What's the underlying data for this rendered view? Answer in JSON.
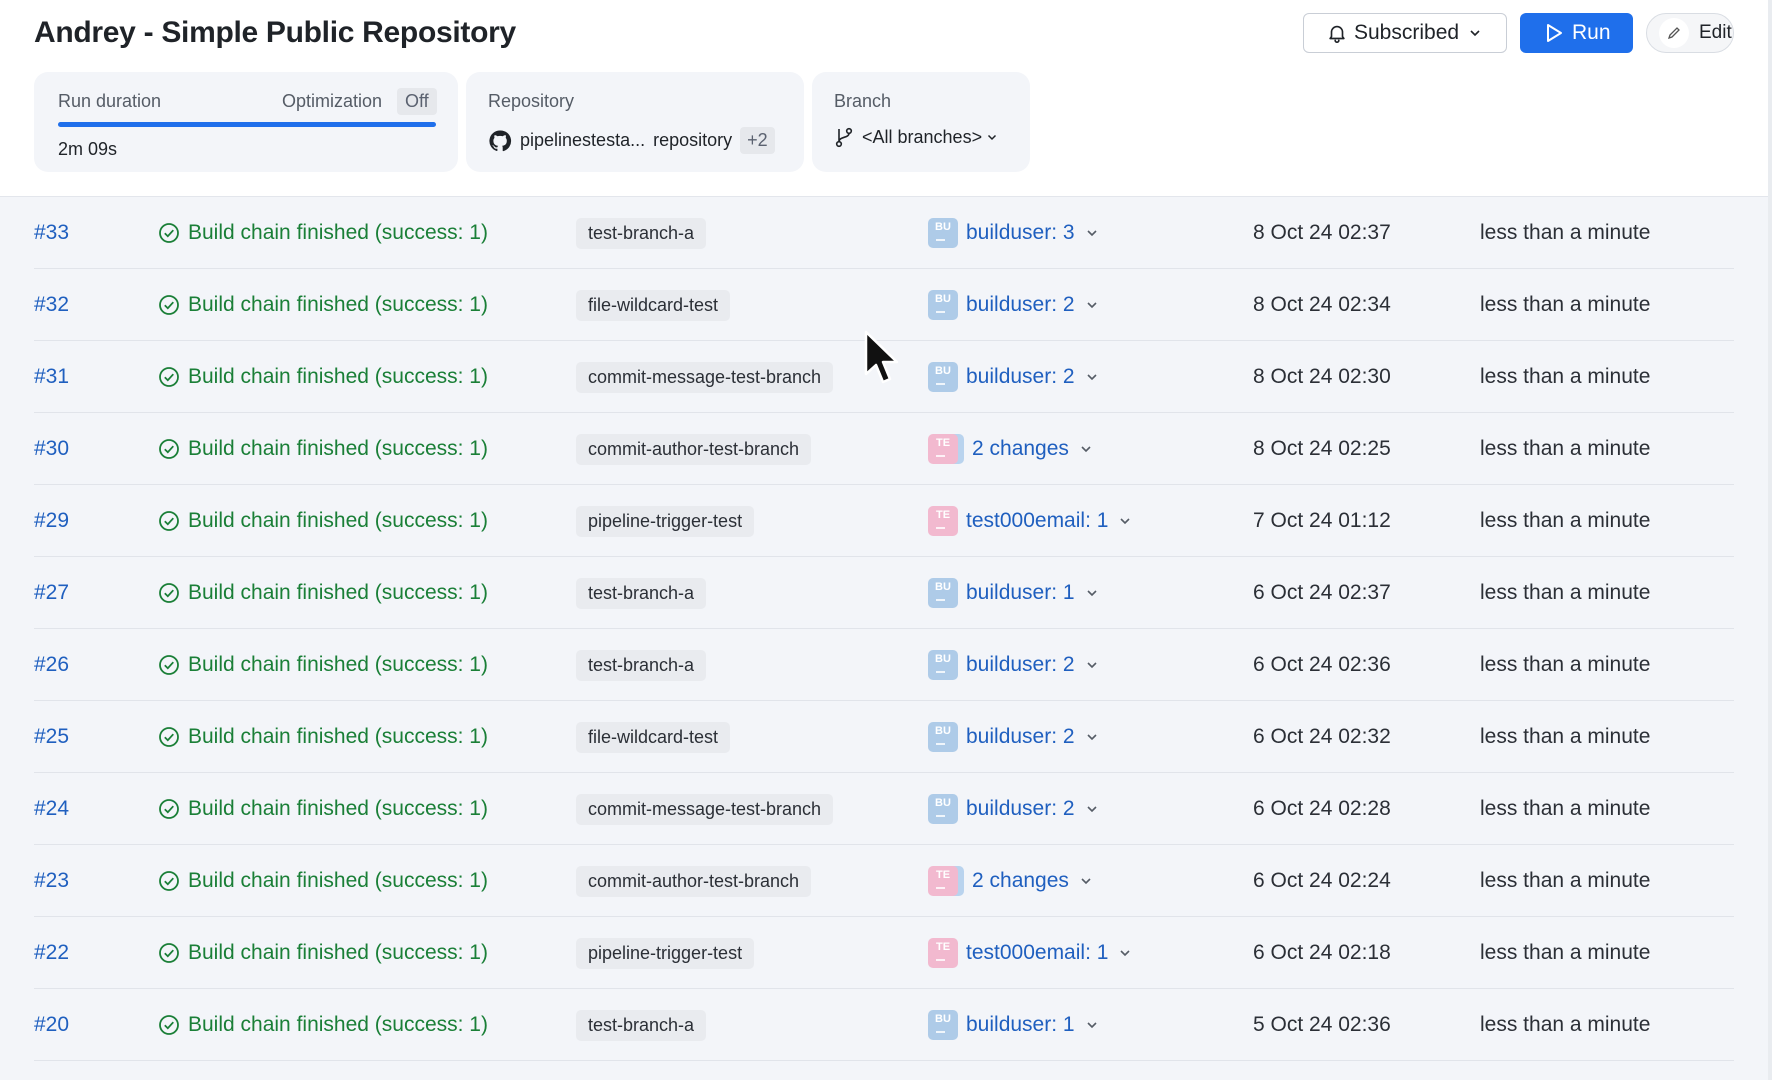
{
  "title": "Andrey - Simple Public Repository",
  "actions": {
    "subscribed_label": "Subscribed",
    "run_label": "Run",
    "edit_label": "Edit"
  },
  "stats": {
    "run_duration_label": "Run duration",
    "optimization_label": "Optimization",
    "optimization_value": "Off",
    "run_duration_value": "2m 09s",
    "repository_label": "Repository",
    "repository_name": "pipelinestesta...",
    "repository_suffix": "repository",
    "repository_extra": "+2",
    "branch_label": "Branch",
    "branch_value": "<All branches>"
  },
  "colors": {
    "accent": "#1f6feb",
    "success": "#1a7f37",
    "link": "#1f5fbf"
  },
  "runs": [
    {
      "id": "#33",
      "status": "Build chain finished (success: 1)",
      "branch": "test-branch-a",
      "avatar": "BU",
      "change": "builduser: 3",
      "date": "8 Oct 24 02:37",
      "duration": "less than a minute"
    },
    {
      "id": "#32",
      "status": "Build chain finished (success: 1)",
      "branch": "file-wildcard-test",
      "avatar": "BU",
      "change": "builduser: 2",
      "date": "8 Oct 24 02:34",
      "duration": "less than a minute"
    },
    {
      "id": "#31",
      "status": "Build chain finished (success: 1)",
      "branch": "commit-message-test-branch",
      "avatar": "BU",
      "change": "builduser: 2",
      "date": "8 Oct 24 02:30",
      "duration": "less than a minute"
    },
    {
      "id": "#30",
      "status": "Build chain finished (success: 1)",
      "branch": "commit-author-test-branch",
      "avatar": "TE",
      "change": "2 changes",
      "date": "8 Oct 24 02:25",
      "duration": "less than a minute"
    },
    {
      "id": "#29",
      "status": "Build chain finished (success: 1)",
      "branch": "pipeline-trigger-test",
      "avatar": "TE",
      "change": "test000email: 1",
      "date": "7 Oct 24 01:12",
      "duration": "less than a minute"
    },
    {
      "id": "#27",
      "status": "Build chain finished (success: 1)",
      "branch": "test-branch-a",
      "avatar": "BU",
      "change": "builduser: 1",
      "date": "6 Oct 24 02:37",
      "duration": "less than a minute"
    },
    {
      "id": "#26",
      "status": "Build chain finished (success: 1)",
      "branch": "test-branch-a",
      "avatar": "BU",
      "change": "builduser: 2",
      "date": "6 Oct 24 02:36",
      "duration": "less than a minute"
    },
    {
      "id": "#25",
      "status": "Build chain finished (success: 1)",
      "branch": "file-wildcard-test",
      "avatar": "BU",
      "change": "builduser: 2",
      "date": "6 Oct 24 02:32",
      "duration": "less than a minute"
    },
    {
      "id": "#24",
      "status": "Build chain finished (success: 1)",
      "branch": "commit-message-test-branch",
      "avatar": "BU",
      "change": "builduser: 2",
      "date": "6 Oct 24 02:28",
      "duration": "less than a minute"
    },
    {
      "id": "#23",
      "status": "Build chain finished (success: 1)",
      "branch": "commit-author-test-branch",
      "avatar": "TE",
      "change": "2 changes",
      "date": "6 Oct 24 02:24",
      "duration": "less than a minute"
    },
    {
      "id": "#22",
      "status": "Build chain finished (success: 1)",
      "branch": "pipeline-trigger-test",
      "avatar": "TE",
      "change": "test000email: 1",
      "date": "6 Oct 24 02:18",
      "duration": "less than a minute"
    },
    {
      "id": "#20",
      "status": "Build chain finished (success: 1)",
      "branch": "test-branch-a",
      "avatar": "BU",
      "change": "builduser: 1",
      "date": "5 Oct 24 02:36",
      "duration": "less than a minute"
    }
  ]
}
